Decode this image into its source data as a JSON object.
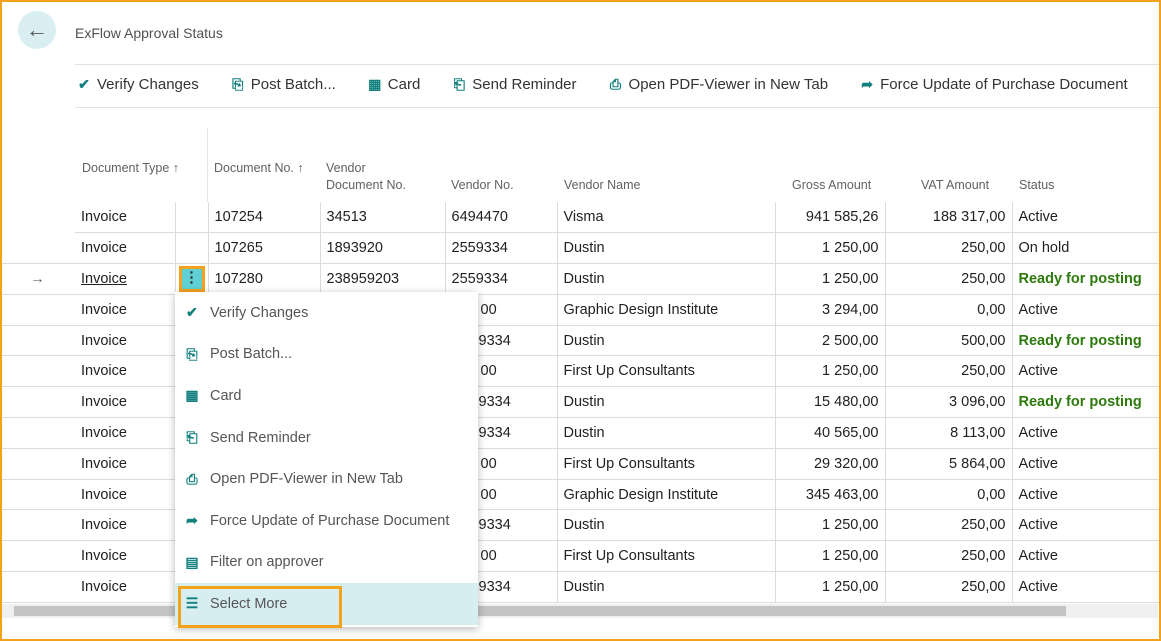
{
  "page": {
    "title": "ExFlow Approval Status",
    "back_icon": "arrow-left-icon"
  },
  "toolbar": [
    {
      "label": "Verify Changes",
      "icon": "verify-icon"
    },
    {
      "label": "Post Batch...",
      "icon": "post-batch-icon"
    },
    {
      "label": "Card",
      "icon": "card-icon"
    },
    {
      "label": "Send Reminder",
      "icon": "send-reminder-icon"
    },
    {
      "label": "Open PDF-Viewer in New Tab",
      "icon": "pdf-viewer-icon"
    },
    {
      "label": "Force Update of Purchase Document",
      "icon": "force-update-icon"
    }
  ],
  "columns": {
    "doc_type": "Document Type ↑",
    "doc_no": "Document No. ↑",
    "vendor_doc_no": "Vendor Document No.",
    "vendor_no": "Vendor No.",
    "vendor_name": "Vendor Name",
    "gross": "Gross Amount",
    "vat": "VAT Amount",
    "status": "Status"
  },
  "rows": [
    {
      "type": "Invoice",
      "doc_no": "107254",
      "vdoc": "34513",
      "vno": "6494470",
      "name": "Visma",
      "gross": "941 585,26",
      "vat": "188 317,00",
      "status": "Active"
    },
    {
      "type": "Invoice",
      "doc_no": "107265",
      "vdoc": "1893920",
      "vno": "2559334",
      "name": "Dustin",
      "gross": "1 250,00",
      "vat": "250,00",
      "status": "On hold"
    },
    {
      "type": "Invoice",
      "doc_no": "107280",
      "vdoc": "238959203",
      "vno": "2559334",
      "name": "Dustin",
      "gross": "1 250,00",
      "vat": "250,00",
      "status": "Ready for posting",
      "selected": true
    },
    {
      "type": "Invoice",
      "doc_no": "",
      "vdoc": "",
      "vno": "00",
      "name": "Graphic Design Institute",
      "gross": "3 294,00",
      "vat": "0,00",
      "status": "Active"
    },
    {
      "type": "Invoice",
      "doc_no": "",
      "vdoc": "",
      "vno": "9334",
      "name": "Dustin",
      "gross": "2 500,00",
      "vat": "500,00",
      "status": "Ready for posting"
    },
    {
      "type": "Invoice",
      "doc_no": "",
      "vdoc": "",
      "vno": "00",
      "name": "First Up Consultants",
      "gross": "1 250,00",
      "vat": "250,00",
      "status": "Active"
    },
    {
      "type": "Invoice",
      "doc_no": "",
      "vdoc": "",
      "vno": "9334",
      "name": "Dustin",
      "gross": "15 480,00",
      "vat": "3 096,00",
      "status": "Ready for posting"
    },
    {
      "type": "Invoice",
      "doc_no": "",
      "vdoc": "",
      "vno": "9334",
      "name": "Dustin",
      "gross": "40 565,00",
      "vat": "8 113,00",
      "status": "Active"
    },
    {
      "type": "Invoice",
      "doc_no": "",
      "vdoc": "",
      "vno": "00",
      "name": "First Up Consultants",
      "gross": "29 320,00",
      "vat": "5 864,00",
      "status": "Active"
    },
    {
      "type": "Invoice",
      "doc_no": "",
      "vdoc": "",
      "vno": "00",
      "name": "Graphic Design Institute",
      "gross": "345 463,00",
      "vat": "0,00",
      "status": "Active"
    },
    {
      "type": "Invoice",
      "doc_no": "",
      "vdoc": "",
      "vno": "9334",
      "name": "Dustin",
      "gross": "1 250,00",
      "vat": "250,00",
      "status": "Active"
    },
    {
      "type": "Invoice",
      "doc_no": "",
      "vdoc": "",
      "vno": "00",
      "name": "First Up Consultants",
      "gross": "1 250,00",
      "vat": "250,00",
      "status": "Active"
    },
    {
      "type": "Invoice",
      "doc_no": "",
      "vdoc": "",
      "vno": "9334",
      "name": "Dustin",
      "gross": "1 250,00",
      "vat": "250,00",
      "status": "Active"
    }
  ],
  "context_menu": [
    {
      "label": "Verify Changes",
      "icon": "verify-icon"
    },
    {
      "label": "Post Batch...",
      "icon": "post-batch-icon"
    },
    {
      "label": "Card",
      "icon": "card-icon"
    },
    {
      "label": "Send Reminder",
      "icon": "send-reminder-icon"
    },
    {
      "label": "Open PDF-Viewer in New Tab",
      "icon": "pdf-viewer-icon"
    },
    {
      "label": "Force Update of Purchase Document",
      "icon": "force-update-icon"
    },
    {
      "label": "Filter on approver",
      "icon": "filter-icon"
    },
    {
      "label": "Select More",
      "icon": "select-more-icon",
      "highlighted": true
    }
  ],
  "colors": {
    "accent": "#11807e",
    "highlight": "#f3a21b",
    "ready": "#2d7a0c"
  }
}
